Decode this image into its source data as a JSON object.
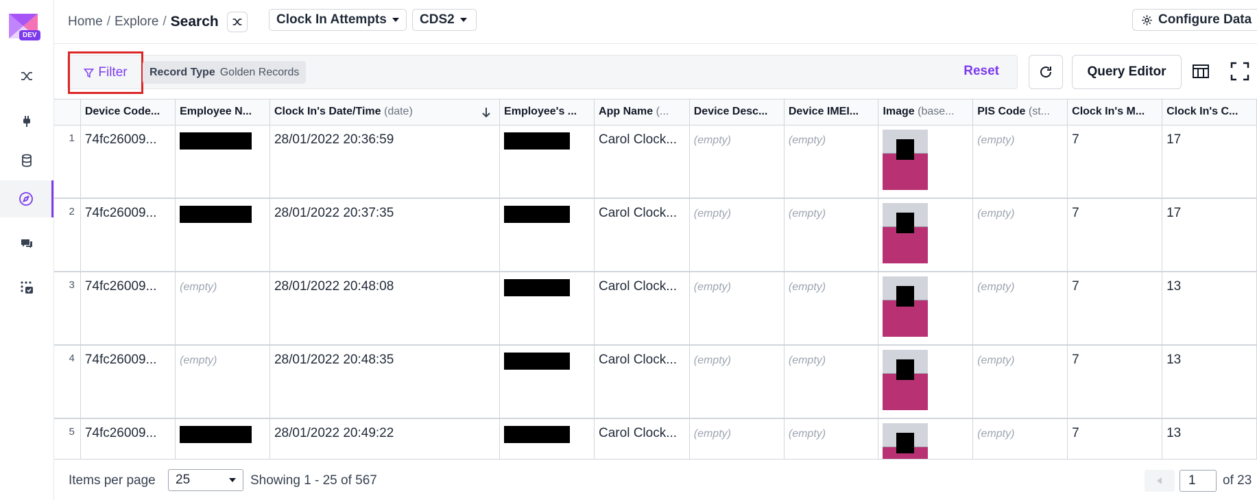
{
  "app": {
    "env_badge": "DEV"
  },
  "breadcrumb": {
    "home": "Home",
    "explore": "Explore",
    "current": "Search",
    "separator": "/"
  },
  "header": {
    "entity_dropdown": "Clock In Attempts",
    "source_dropdown": "CDS2",
    "configure_label": "Configure Data"
  },
  "filterbar": {
    "filter_label": "Filter",
    "chip_key": "Record Type",
    "chip_value": "Golden Records",
    "reset_label": "Reset",
    "query_editor_label": "Query Editor"
  },
  "table": {
    "columns": [
      {
        "label": "Device Code...",
        "type": ""
      },
      {
        "label": "Employee N...",
        "type": ""
      },
      {
        "label": "Clock In's Date/Time",
        "type": "(date)"
      },
      {
        "label": "Employee's ...",
        "type": ""
      },
      {
        "label": "App Name",
        "type": "(..."
      },
      {
        "label": "Device Desc...",
        "type": ""
      },
      {
        "label": "Device IMEI...",
        "type": ""
      },
      {
        "label": "Image",
        "type": "(base..."
      },
      {
        "label": "PIS Code",
        "type": "(st..."
      },
      {
        "label": "Clock In's M...",
        "type": ""
      },
      {
        "label": "Clock In's C...",
        "type": ""
      }
    ],
    "empty_text": "(empty)",
    "rows": [
      {
        "index": "1",
        "device_code": "74fc26009...",
        "datetime": "28/01/2022 20:36:59",
        "app_name": "Carol Clock...",
        "month": "7",
        "count": "17"
      },
      {
        "index": "2",
        "device_code": "74fc26009...",
        "datetime": "28/01/2022 20:37:35",
        "app_name": "Carol Clock...",
        "month": "7",
        "count": "17"
      },
      {
        "index": "3",
        "device_code": "74fc26009...",
        "datetime": "28/01/2022 20:48:08",
        "app_name": "Carol Clock...",
        "month": "7",
        "count": "13"
      },
      {
        "index": "4",
        "device_code": "74fc26009...",
        "datetime": "28/01/2022 20:48:35",
        "app_name": "Carol Clock...",
        "month": "7",
        "count": "13"
      },
      {
        "index": "5",
        "device_code": "74fc26009...",
        "datetime": "28/01/2022 20:49:22",
        "app_name": "Carol Clock...",
        "month": "7",
        "count": "13"
      }
    ]
  },
  "footer": {
    "items_per_page_label": "Items per page",
    "items_per_page_value": "25",
    "showing": "Showing 1 - 25 of 567",
    "current_page": "1",
    "page_total": "of 23"
  },
  "colors": {
    "accent": "#7c3aed",
    "highlight_border": "#dc2626"
  }
}
